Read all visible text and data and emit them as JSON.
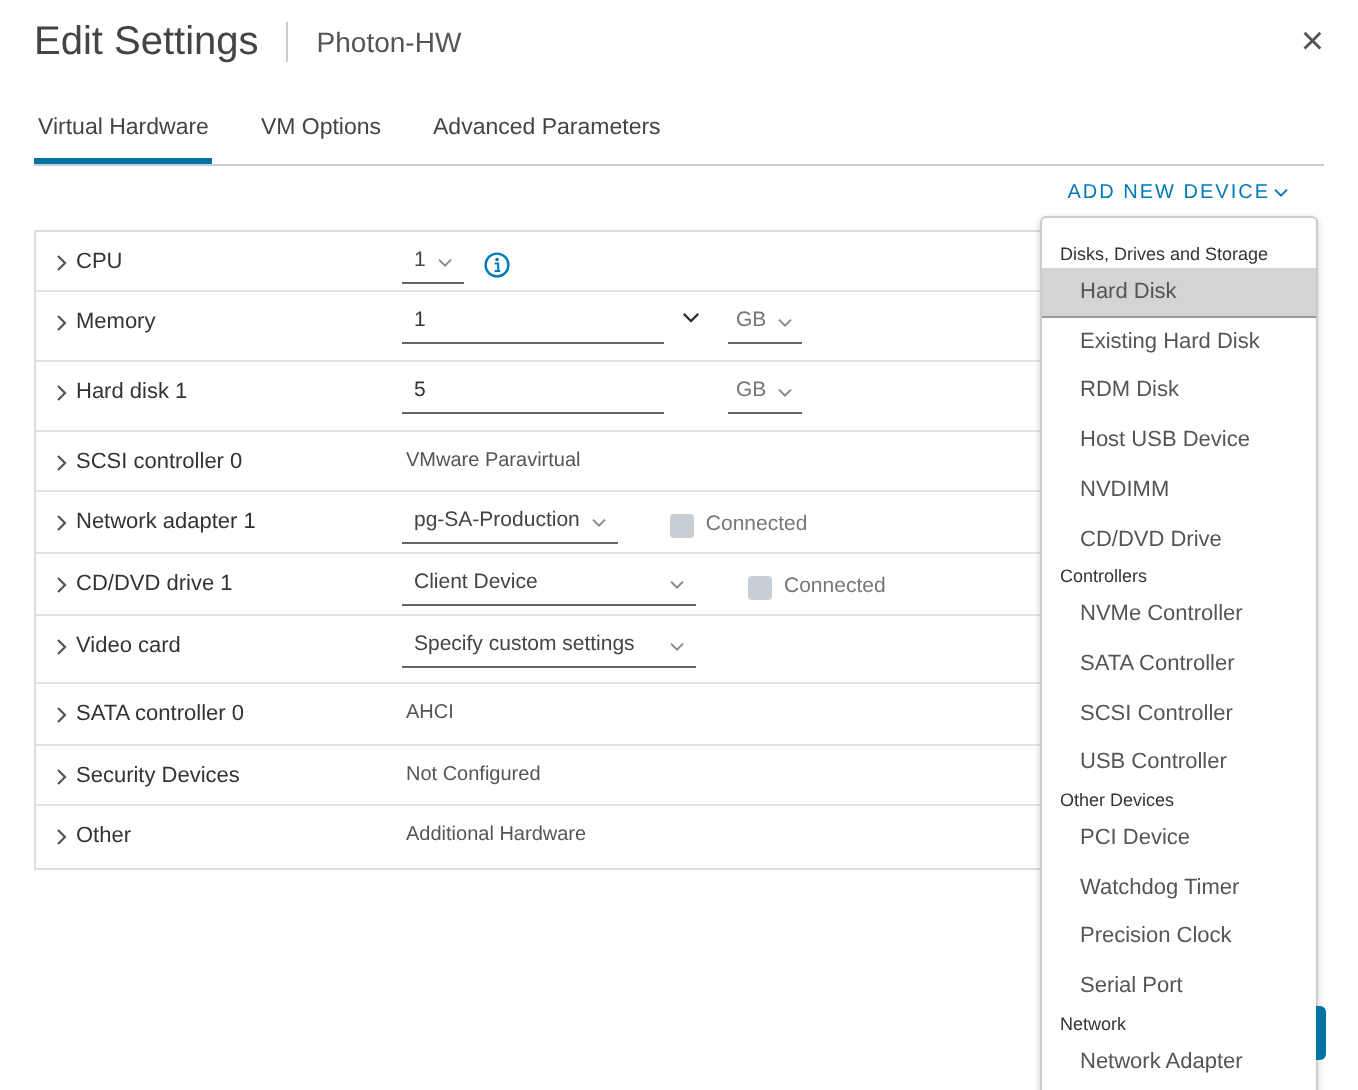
{
  "dialog": {
    "title": "Edit Settings",
    "subtitle": "Photon-HW",
    "close": "×"
  },
  "tabs": [
    {
      "label": "Virtual Hardware",
      "selected": true
    },
    {
      "label": "VM Options",
      "selected": false
    },
    {
      "label": "Advanced Parameters",
      "selected": false
    }
  ],
  "add_device": {
    "label": "ADD NEW DEVICE",
    "expanded": true
  },
  "hardware": [
    {
      "label": "CPU",
      "kind": "select",
      "value": "1",
      "info": true
    },
    {
      "label": "Memory",
      "kind": "input",
      "value": "1",
      "combo": true,
      "unit": "GB"
    },
    {
      "label": "Hard disk 1",
      "kind": "input",
      "value": "5",
      "combo": false,
      "unit": "GB"
    },
    {
      "label": "SCSI controller 0",
      "kind": "text",
      "value": "VMware Paravirtual"
    },
    {
      "label": "Network adapter 1",
      "kind": "select",
      "value": "pg-SA-Production",
      "connected": {
        "label": "Connected",
        "checked": false
      }
    },
    {
      "label": "CD/DVD drive 1",
      "kind": "select",
      "value": "Client Device",
      "wide": true,
      "connected": {
        "label": "Connected",
        "checked": false
      }
    },
    {
      "label": "Video card",
      "kind": "select",
      "value": "Specify custom settings",
      "wide": true
    },
    {
      "label": "SATA controller 0",
      "kind": "text",
      "value": "AHCI"
    },
    {
      "label": "Security Devices",
      "kind": "text",
      "value": "Not Configured"
    },
    {
      "label": "Other",
      "kind": "text",
      "value": "Additional Hardware"
    }
  ],
  "device_menu": [
    {
      "header": "Disks, Drives and Storage",
      "items": [
        {
          "label": "Hard Disk",
          "selected": true
        },
        {
          "label": "Existing Hard Disk",
          "selected": false
        },
        {
          "label": "RDM Disk",
          "selected": false
        },
        {
          "label": "Host USB Device",
          "selected": false
        },
        {
          "label": "NVDIMM",
          "selected": false
        },
        {
          "label": "CD/DVD Drive",
          "selected": false
        }
      ]
    },
    {
      "header": "Controllers",
      "items": [
        {
          "label": "NVMe Controller",
          "selected": false
        },
        {
          "label": "SATA Controller",
          "selected": false
        },
        {
          "label": "SCSI Controller",
          "selected": false
        },
        {
          "label": "USB Controller",
          "selected": false
        }
      ]
    },
    {
      "header": "Other Devices",
      "items": [
        {
          "label": "PCI Device",
          "selected": false
        },
        {
          "label": "Watchdog Timer",
          "selected": false
        },
        {
          "label": "Precision Clock",
          "selected": false
        },
        {
          "label": "Serial Port",
          "selected": false
        }
      ]
    },
    {
      "header": "Network",
      "items": [
        {
          "label": "Network Adapter",
          "selected": false
        }
      ]
    }
  ]
}
